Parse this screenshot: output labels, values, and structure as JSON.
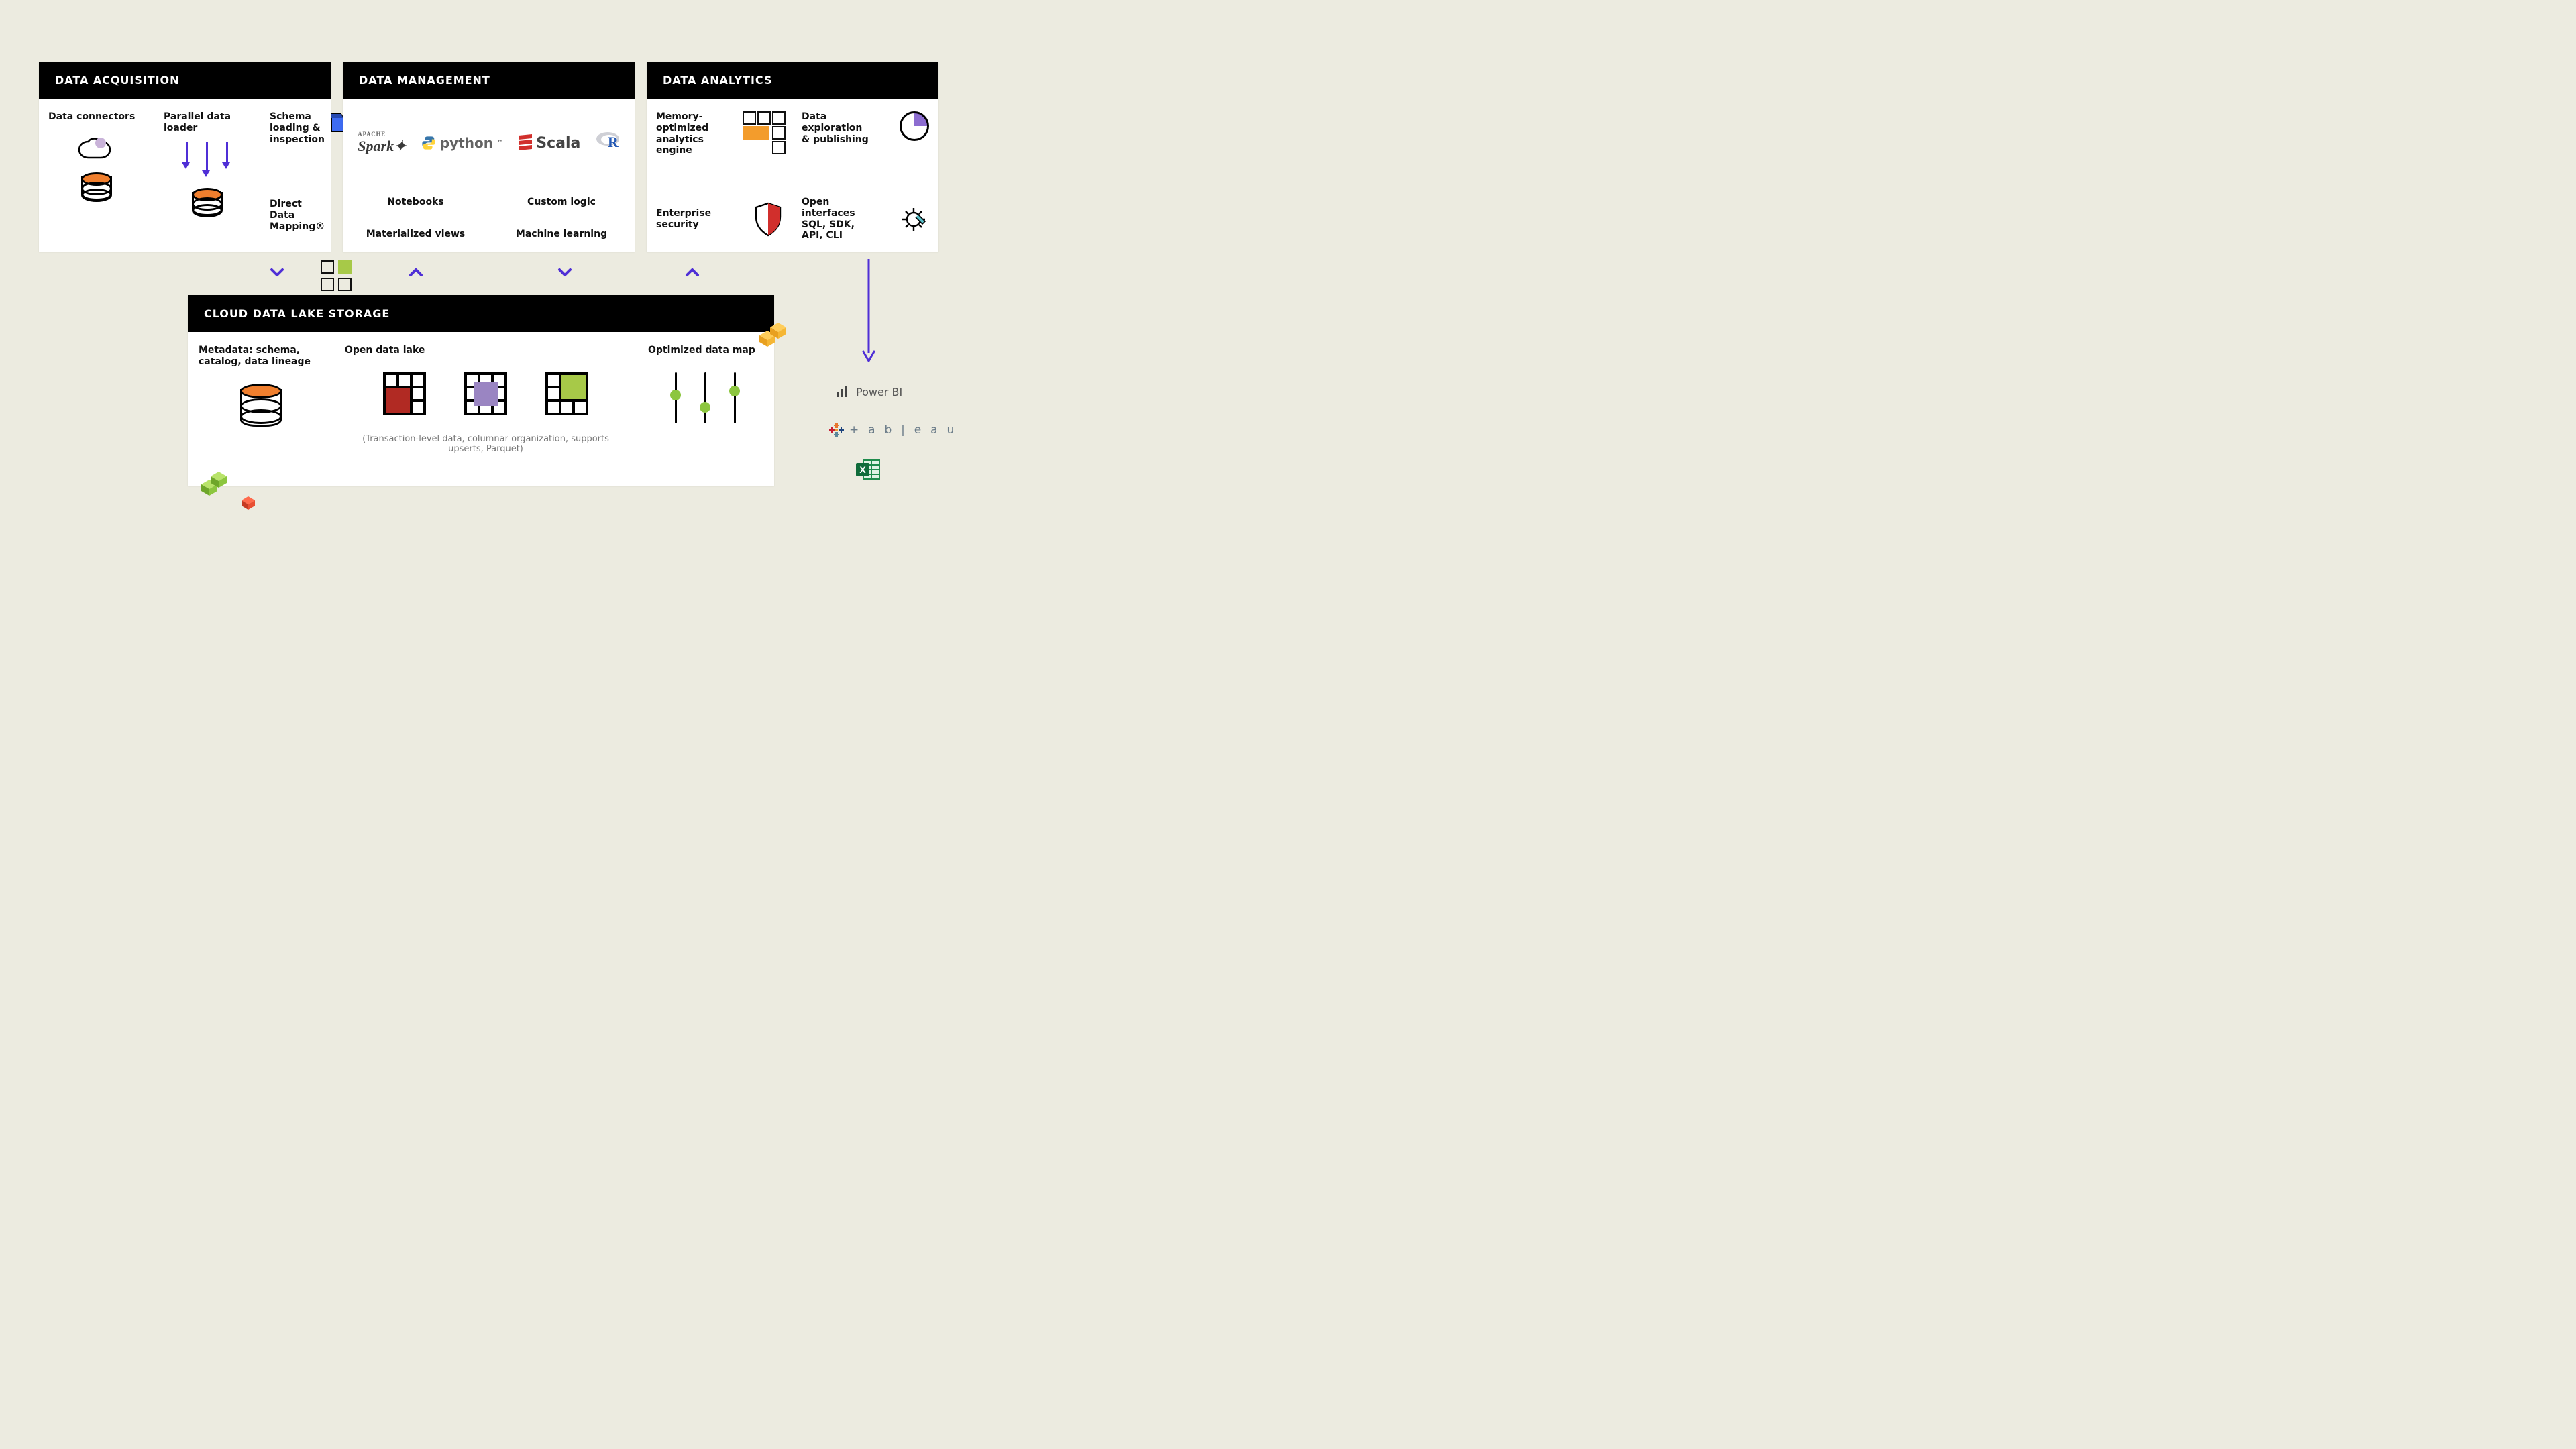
{
  "panels": {
    "acquisition": {
      "title": "DATA ACQUISITION"
    },
    "management": {
      "title": "DATA MANAGEMENT"
    },
    "analytics": {
      "title": "DATA ANALYTICS"
    },
    "storage": {
      "title": "CLOUD DATA LAKE STORAGE"
    }
  },
  "acquisition": {
    "connectors": "Data connectors",
    "parallel_loader": "Parallel data loader",
    "schema": "Schema loading & inspection",
    "direct_data_mapping": "Direct Data Mapping®"
  },
  "management": {
    "tools": {
      "spark": "Spark",
      "spark_small": "APACHE",
      "python": "python",
      "scala": "Scala",
      "r": "R"
    },
    "grid": {
      "notebooks": "Notebooks",
      "custom_logic": "Custom logic",
      "materialized_views": "Materialized views",
      "machine_learning": "Machine learning"
    }
  },
  "analytics": {
    "engine": "Memory-optimized analytics engine",
    "exploration": "Data exploration & publishing",
    "security": "Enterprise security",
    "open_interfaces": "Open interfaces SQL, SDK, API, CLI"
  },
  "storage": {
    "metadata": "Metadata: schema, catalog, data lineage",
    "open_data_lake": "Open data lake",
    "optimized_map": "Optimized data map",
    "subtext": "(Transaction-level data, columnar organization, supports upserts, Parquet)"
  },
  "destinations": {
    "powerbi": "Power BI",
    "tableau": "+ a b | e a u",
    "excel": "Excel"
  },
  "icons": {
    "cloud": "cloud-icon",
    "database": "database-icon",
    "arrows_down": "arrows-down-icon",
    "folder": "folder-icon",
    "squares4": "four-squares-icon",
    "pie": "pie-chart-icon",
    "shield": "shield-icon",
    "gear": "gear-wrench-icon",
    "grid_red": "data-grid-red-icon",
    "grid_purple": "data-grid-purple-icon",
    "grid_green": "data-grid-green-icon",
    "lollipops": "scatter-points-icon"
  },
  "colors": {
    "accent": "#4f2fd6",
    "orange": "#f39c2c",
    "red": "#b12a23",
    "purple": "#9a85c2",
    "green": "#a7c948",
    "limegreen": "#8cc63f",
    "teal": "#58bfc9",
    "amber": "#f9b233"
  }
}
